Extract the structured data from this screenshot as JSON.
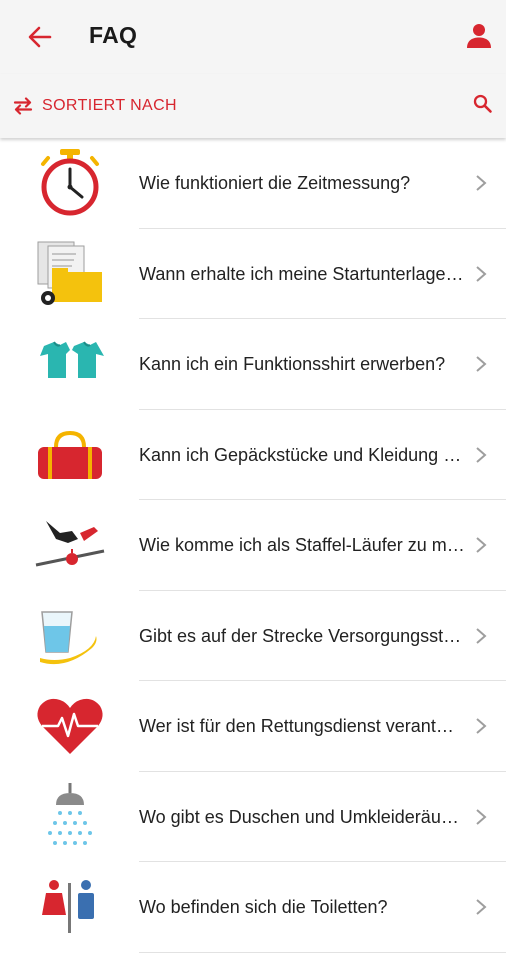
{
  "header": {
    "title": "FAQ"
  },
  "toolbar": {
    "sort_label": "SORTIERT NACH"
  },
  "colors": {
    "accent": "#d7262f",
    "text": "#222222",
    "bar": "#f5f5f5"
  },
  "faq": [
    {
      "question": "Wie funktioniert die Zeitmessung?",
      "icon": "stopwatch-icon"
    },
    {
      "question": "Wann erhalte ich meine Startunterlagen?",
      "icon": "start-documents-icon"
    },
    {
      "question": "Kann ich ein Funktionsshirt erwerben?",
      "icon": "shirt-icon"
    },
    {
      "question": "Kann ich Gepäckstücke und Kleidung abgeben?",
      "icon": "bag-icon"
    },
    {
      "question": "Wie komme ich als Staffel-Läufer zu meinem Wechselpunkt?",
      "icon": "relay-handover-icon"
    },
    {
      "question": "Gibt es auf der Strecke Versorgungsstationen?",
      "icon": "refreshment-icon"
    },
    {
      "question": "Wer ist für den Rettungsdienst verantwortlich?",
      "icon": "heart-icon"
    },
    {
      "question": "Wo gibt es Duschen und Umkleideräume?",
      "icon": "shower-icon"
    },
    {
      "question": "Wo befinden sich die Toiletten?",
      "icon": "toilet-icon"
    }
  ]
}
